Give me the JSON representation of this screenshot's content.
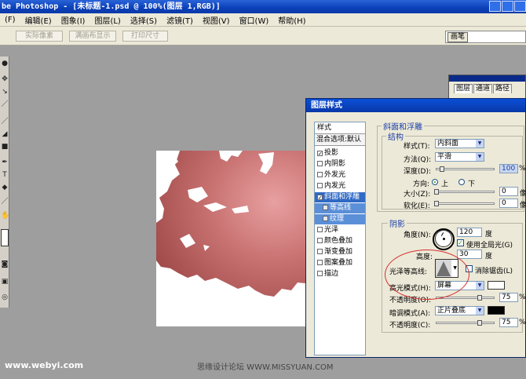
{
  "window": {
    "title": "be Photoshop - [未标题-1.psd @ 100%(图层 1,RGB)]"
  },
  "menu": [
    "(F)",
    "编辑(E)",
    "图象(I)",
    "图层(L)",
    "选择(S)",
    "滤镜(T)",
    "视图(V)",
    "窗口(W)",
    "帮助(H)"
  ],
  "options": {
    "buttons": [
      "实际像素",
      "满画布显示",
      "打印尺寸"
    ],
    "palette_tab": "画笔"
  },
  "layers_panel": {
    "tabs": [
      "图层",
      "通道",
      "路径"
    ]
  },
  "dialog": {
    "title": "图层样式",
    "styles_header": "样式",
    "blend_options": "混合选项:默认",
    "styles": [
      {
        "label": "投影",
        "checked": true
      },
      {
        "label": "内阴影",
        "checked": false
      },
      {
        "label": "外发光",
        "checked": false
      },
      {
        "label": "内发光",
        "checked": false
      },
      {
        "label": "斜面和浮雕",
        "checked": true
      },
      {
        "label": "等高线",
        "checked": false
      },
      {
        "label": "纹理",
        "checked": false
      },
      {
        "label": "光泽",
        "checked": false
      },
      {
        "label": "颜色叠加",
        "checked": false
      },
      {
        "label": "渐变叠加",
        "checked": false
      },
      {
        "label": "图案叠加",
        "checked": false
      },
      {
        "label": "描边",
        "checked": false
      }
    ],
    "check_mark": "✓",
    "bevel": {
      "group_title": "斜面和浮雕",
      "structure_title": "结构",
      "style_label": "样式(T):",
      "style_value": "内斜面",
      "technique_label": "方法(Q):",
      "technique_value": "平滑",
      "depth_label": "深度(D):",
      "depth_value": "100",
      "depth_unit": "%",
      "depth_fraction": 0.1,
      "direction_label": "方向:",
      "direction_up": "上",
      "direction_down": "下",
      "size_label": "大小(Z):",
      "size_value": "0",
      "size_unit": "像",
      "soften_label": "软化(E):",
      "soften_value": "0",
      "soften_unit": "像"
    },
    "shading": {
      "title": "阴影",
      "angle_label": "角度(N):",
      "angle_value": "120",
      "angle_unit": "度",
      "global_light_label": "使用全局光(G)",
      "global_light": true,
      "altitude_label": "高度:",
      "altitude_value": "30",
      "altitude_unit": "度",
      "gloss_label": "光泽等高线:",
      "antialias_label": "消除锯齿(L)",
      "antialias": false,
      "highlight_mode_label": "高光模式(H):",
      "highlight_mode": "屏幕",
      "highlight_color": "#ffffff",
      "highlight_opacity_label": "不透明度(O):",
      "highlight_opacity": "75",
      "highlight_opacity_fraction": 0.75,
      "shadow_mode_label": "暗调模式(A):",
      "shadow_mode": "正片叠底",
      "shadow_color": "#000000",
      "shadow_opacity_label": "不透明度(C):",
      "shadow_opacity": "75",
      "shadow_opacity_fraction": 0.75,
      "percent": "%"
    }
  },
  "watermarks": {
    "left": "www.webyi.com",
    "middle": "思缘设计论坛 WWW.MISSYUAN.COM"
  },
  "colors": {
    "title_bar": "#0a3fb8",
    "accent_selected": "#316ac5",
    "canvas_red": "#b85a5a",
    "annotation": "#d83030"
  }
}
